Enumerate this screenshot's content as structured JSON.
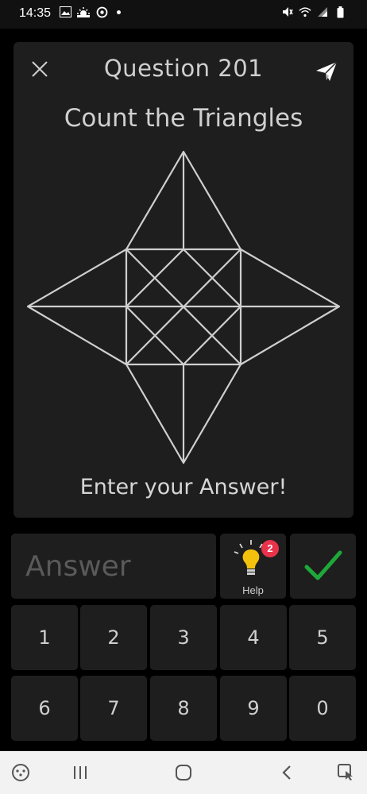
{
  "status_bar": {
    "time": "14:35",
    "left_icons": [
      "image-icon",
      "weather-icon",
      "sync-icon",
      "notification-dot-icon"
    ],
    "right_icons": [
      "mute-icon",
      "wifi-icon",
      "signal-icon",
      "battery-icon"
    ]
  },
  "header": {
    "title": "Question 201",
    "close_icon": "close-icon",
    "share_icon": "paper-plane-icon"
  },
  "puzzle": {
    "subtitle": "Count the Triangles",
    "prompt": "Enter your Answer!"
  },
  "answer": {
    "placeholder": "Answer",
    "value": ""
  },
  "help": {
    "label": "Help",
    "badge": "2",
    "icon": "lightbulb-icon"
  },
  "submit": {
    "icon": "checkmark-icon"
  },
  "keypad": {
    "keys": [
      "1",
      "2",
      "3",
      "4",
      "5",
      "6",
      "7",
      "8",
      "9",
      "0"
    ]
  },
  "nav_bar": {
    "icons": [
      "game-launcher-icon",
      "recents-icon",
      "home-icon",
      "back-icon",
      "accessibility-icon"
    ]
  },
  "colors": {
    "background": "#000000",
    "panel": "#1e1e1e",
    "text": "#cfcfcf",
    "badge": "#e8334a",
    "check": "#1fa83a",
    "bulb": "#f4c20d"
  }
}
